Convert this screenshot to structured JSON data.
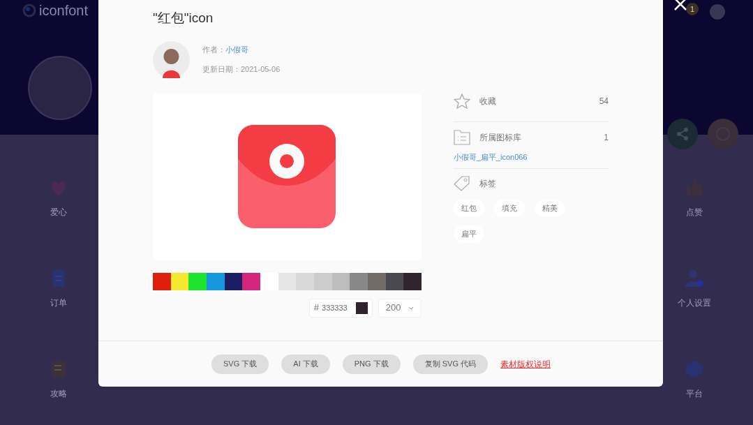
{
  "background_page": {
    "logo": "iconfont",
    "notification_count": "1",
    "left_menu": [
      {
        "label": "爱心",
        "kind": "heart"
      },
      {
        "label": "订单",
        "kind": "clipboard"
      },
      {
        "label": "攻略",
        "kind": "note"
      }
    ],
    "right_menu": [
      {
        "label": "点赞",
        "kind": "thumb"
      },
      {
        "label": "个人设置",
        "kind": "user"
      },
      {
        "label": "平台",
        "kind": "layers"
      }
    ]
  },
  "dialog": {
    "title": "\"红包\"icon",
    "author_label": "作者：",
    "author": "小假哥",
    "date_label": "更新日期：",
    "date": "2021-05-06",
    "palette": [
      {
        "color": "#dd1f0b"
      },
      {
        "color": "#f5e92f"
      },
      {
        "color": "#1de52f"
      },
      {
        "color": "#1597dd"
      },
      {
        "color": "#181f65"
      },
      {
        "color": "#d5247b"
      },
      {
        "color": "#ffffff"
      },
      {
        "color": "#e6e6e6"
      },
      {
        "color": "#d9d9d9"
      },
      {
        "color": "#cccccc"
      },
      {
        "color": "#bdbdbd"
      },
      {
        "color": "#888888"
      },
      {
        "color": "#726b66"
      },
      {
        "color": "#4a4952"
      },
      {
        "color": "#30252e"
      }
    ],
    "color_field": {
      "hash": "#",
      "value": "333333",
      "color": "#30252e"
    },
    "size_select": {
      "value": "200"
    },
    "favorites": {
      "label": "收藏",
      "count": "54"
    },
    "library": {
      "label": "所属图标库",
      "count": "1",
      "link": "小假哥_扁平_icon066"
    },
    "tags": {
      "label": "标签",
      "items": [
        "红包",
        "填充",
        "精美",
        "扁平"
      ]
    },
    "buttons": [
      "SVG 下载",
      "AI 下载",
      "PNG 下载",
      "复制 SVG 代码"
    ],
    "license_link": "素材版权说明"
  }
}
